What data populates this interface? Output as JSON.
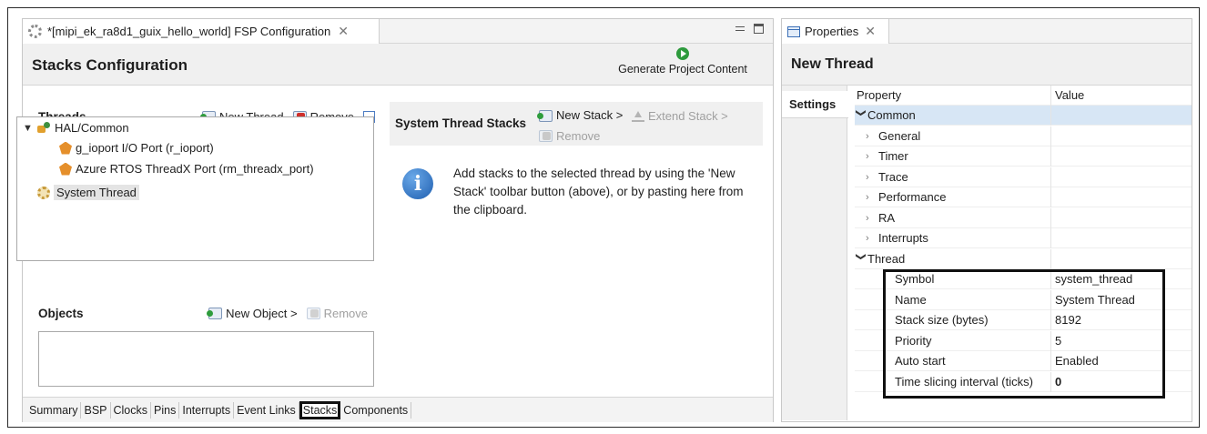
{
  "editor": {
    "tab_title": "*[mipi_ek_ra8d1_guix_hello_world] FSP Configuration",
    "header_title": "Stacks Configuration",
    "generate_label": "Generate Project Content"
  },
  "threads": {
    "title": "Threads",
    "new_thread": "New Thread",
    "remove": "Remove",
    "items": [
      {
        "label": "HAL/Common"
      },
      {
        "label": "g_ioport I/O Port (r_ioport)"
      },
      {
        "label": "Azure RTOS ThreadX Port (rm_threadx_port)"
      },
      {
        "label": "System Thread"
      }
    ]
  },
  "objects": {
    "title": "Objects",
    "new_object": "New Object >",
    "remove": "Remove"
  },
  "stacks": {
    "title": "System Thread Stacks",
    "new_stack": "New Stack >",
    "extend_stack": "Extend Stack >",
    "remove": "Remove",
    "info": "Add stacks to the selected thread by using the 'New Stack' toolbar button (above), or by pasting here from the clipboard."
  },
  "bottom_tabs": [
    "Summary",
    "BSP",
    "Clocks",
    "Pins",
    "Interrupts",
    "Event Links",
    "Stacks",
    "Components"
  ],
  "properties": {
    "tab_title": "Properties",
    "header_title": "New Thread",
    "settings_tab": "Settings",
    "col_property": "Property",
    "col_value": "Value",
    "rows": [
      {
        "key": "Common",
        "value": ""
      },
      {
        "key": "General",
        "value": ""
      },
      {
        "key": "Timer",
        "value": ""
      },
      {
        "key": "Trace",
        "value": ""
      },
      {
        "key": "Performance",
        "value": ""
      },
      {
        "key": "RA",
        "value": ""
      },
      {
        "key": "Interrupts",
        "value": ""
      },
      {
        "key": "Thread",
        "value": ""
      },
      {
        "key": "Symbol",
        "value": "system_thread"
      },
      {
        "key": "Name",
        "value": "System Thread"
      },
      {
        "key": "Stack size (bytes)",
        "value": "8192"
      },
      {
        "key": "Priority",
        "value": "5"
      },
      {
        "key": "Auto start",
        "value": "Enabled"
      },
      {
        "key": "Time slicing interval (ticks)",
        "value": "0"
      }
    ]
  }
}
